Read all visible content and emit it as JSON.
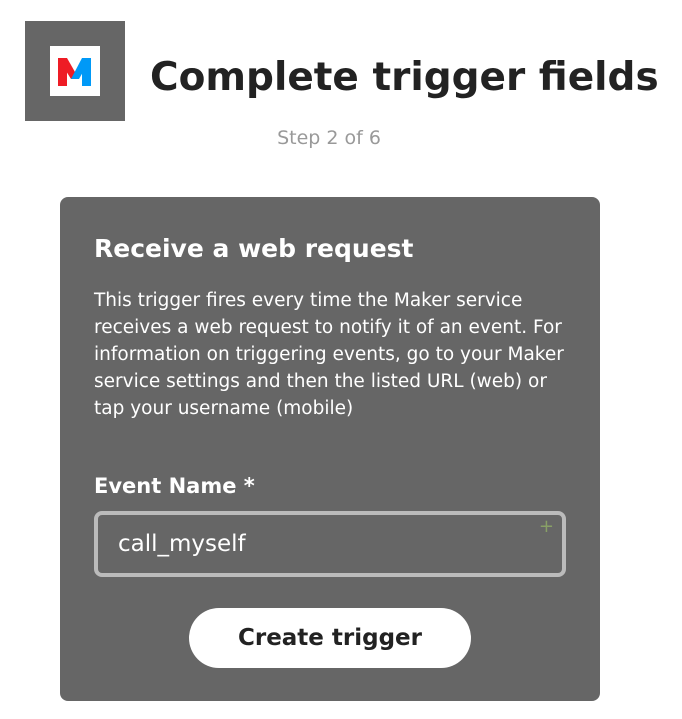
{
  "header": {
    "title": "Complete trigger fields",
    "step": "Step 2 of 6",
    "service_icon": "maker-logo-icon",
    "logo_colors": {
      "box": "#666666",
      "red": "#ee1c25",
      "blue": "#0099f7"
    }
  },
  "trigger": {
    "title": "Receive a web request",
    "description": "This trigger fires every time the Maker service receives a web request to notify it of an event. For information on triggering events, go to your Maker service settings and then the listed URL (web) or tap your username (mobile)",
    "field": {
      "label": "Event Name *",
      "value": "call_myself",
      "add_ingredient_icon": "plus-icon"
    },
    "submit_label": "Create trigger"
  }
}
